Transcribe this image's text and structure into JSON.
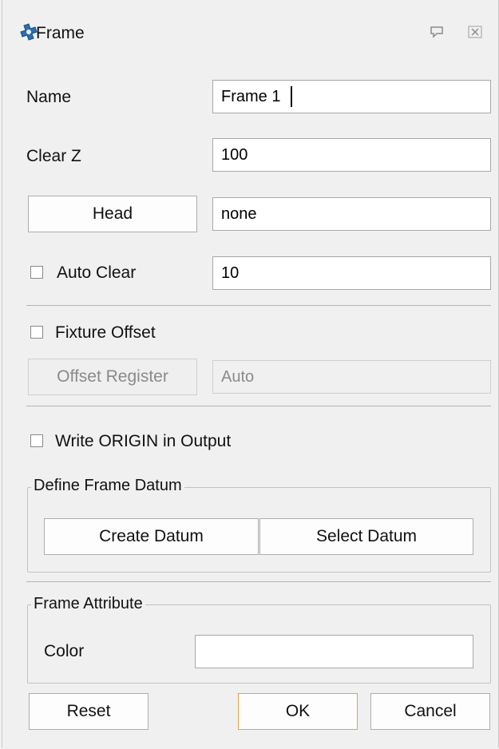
{
  "window": {
    "title": "Frame",
    "icons": {
      "app": "frame-app-icon",
      "pin": "pin-icon",
      "close": "close-icon"
    }
  },
  "fields": {
    "name": {
      "label": "Name",
      "value": "Frame 1"
    },
    "clear_z": {
      "label": "Clear Z",
      "value": "100"
    },
    "head": {
      "button_label": "Head",
      "value": "none"
    },
    "auto_clear": {
      "label": "Auto Clear",
      "value": "10",
      "checked": false
    }
  },
  "fixture": {
    "label": "Fixture Offset",
    "checked": false,
    "offset_register_label": "Offset Register",
    "offset_value": "Auto"
  },
  "write_origin": {
    "label": "Write ORIGIN in Output",
    "checked": false
  },
  "datum_group": {
    "title": "Define Frame Datum",
    "create_label": "Create Datum",
    "select_label": "Select Datum"
  },
  "attribute_group": {
    "title": "Frame Attribute",
    "color_label": "Color",
    "color_value": ""
  },
  "footer": {
    "reset": "Reset",
    "ok": "OK",
    "cancel": "Cancel"
  },
  "colors": {
    "default_button_border": "#e8a33c",
    "background": "#f0f0f0"
  }
}
